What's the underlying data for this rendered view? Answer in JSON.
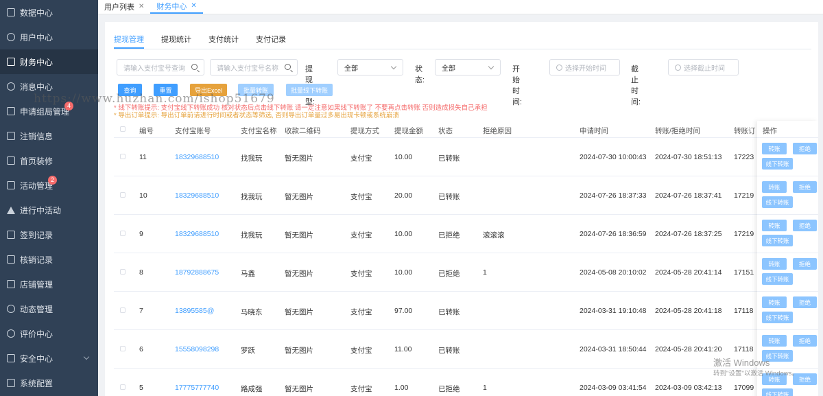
{
  "sidebar": {
    "items": [
      {
        "label": "数据中心",
        "icon": "chart-icon",
        "name": "sidebar-item-data-center",
        "active": false,
        "badge": ""
      },
      {
        "label": "用户中心",
        "icon": "user-icon",
        "name": "sidebar-item-user-center",
        "active": false,
        "badge": ""
      },
      {
        "label": "财务中心",
        "icon": "wallet-icon",
        "name": "sidebar-item-finance-center",
        "active": true,
        "badge": ""
      },
      {
        "label": "消息中心",
        "icon": "message-icon",
        "name": "sidebar-item-message-center",
        "active": false,
        "badge": ""
      },
      {
        "label": "申请组局管理",
        "icon": "apply-icon",
        "name": "sidebar-item-group-apply",
        "active": false,
        "badge": "4"
      },
      {
        "label": "注销信息",
        "icon": "document-icon",
        "name": "sidebar-item-cancel-info",
        "active": false,
        "badge": ""
      },
      {
        "label": "首页装修",
        "icon": "cube-icon",
        "name": "sidebar-item-home-decor",
        "active": false,
        "badge": ""
      },
      {
        "label": "活动管理",
        "icon": "clipboard-icon",
        "name": "sidebar-item-activity-manage",
        "active": false,
        "badge": "2"
      },
      {
        "label": "进行中活动",
        "icon": "send-icon",
        "name": "sidebar-item-ongoing-activity",
        "active": false,
        "badge": ""
      },
      {
        "label": "签到记录",
        "icon": "checkin-icon",
        "name": "sidebar-item-checkin-record",
        "active": false,
        "badge": ""
      },
      {
        "label": "核销记录",
        "icon": "layers-icon",
        "name": "sidebar-item-verify-record",
        "active": false,
        "badge": ""
      },
      {
        "label": "店铺管理",
        "icon": "shop-icon",
        "name": "sidebar-item-shop-manage",
        "active": false,
        "badge": ""
      },
      {
        "label": "动态管理",
        "icon": "pie-icon",
        "name": "sidebar-item-feed-manage",
        "active": false,
        "badge": ""
      },
      {
        "label": "评价中心",
        "icon": "comment-icon",
        "name": "sidebar-item-review-center",
        "active": false,
        "badge": ""
      },
      {
        "label": "安全中心",
        "icon": "shield-icon",
        "name": "sidebar-item-security-center",
        "active": false,
        "badge": "",
        "expandable": true
      },
      {
        "label": "系统配置",
        "icon": "list-icon",
        "name": "sidebar-item-system-config",
        "active": false,
        "badge": ""
      }
    ]
  },
  "tabbar": {
    "tabs": [
      {
        "label": "用户列表",
        "close": "✕",
        "active": false
      },
      {
        "label": "财务中心",
        "close": "✕",
        "active": true
      }
    ]
  },
  "subtabs": [
    "提现管理",
    "提现统计",
    "支付统计",
    "支付记录"
  ],
  "filters": {
    "alipay_account_placeholder": "请输入支付宝号查询",
    "alipay_name_placeholder": "请输入支付宝号名称",
    "withdraw_type_label": "提现类型:",
    "withdraw_type_value": "全部",
    "status_label": "状态:",
    "status_value": "全部",
    "start_label": "开始时间:",
    "start_placeholder": "选择开始时间",
    "end_label": "截止时间:",
    "end_placeholder": "选择截止时间"
  },
  "buttons": {
    "query": "查询",
    "reset": "重置",
    "export": "导出Excel",
    "batch_transfer": "批量转账",
    "batch_offline": "批量线下转账"
  },
  "tips": {
    "offline": "* 线下转账提示:  支付宝线下转账成功 核对状态后点击线下转账 请一定注意如果线下转账了 不要再点击转账 否则造成损失自己承担",
    "export": "* 导出订单提示:  导出订单前请进行时间或者状态等筛选, 否则导出订单量过多易出现卡顿或系统崩溃"
  },
  "table": {
    "headers": {
      "id": "编号",
      "account": "支付宝账号",
      "name": "支付宝名称",
      "qrcode": "收款二维码",
      "method": "提现方式",
      "amount": "提现金额",
      "status": "状态",
      "reason": "拒绝原因",
      "apply_time": "申请时间",
      "handle_time": "转账/拒绝时间",
      "order_no": "转账订",
      "ops": "操作"
    },
    "rows": [
      {
        "id": "11",
        "account": "18329688510",
        "name": "找我玩",
        "qrcode": "暂无图片",
        "method": "支付宝",
        "amount": "10.00",
        "status": "已转账",
        "reason": "",
        "apply_time": "2024-07-30 10:00:43",
        "handle_time": "2024-07-30 18:51:13",
        "order_no": "17223"
      },
      {
        "id": "10",
        "account": "18329688510",
        "name": "找我玩",
        "qrcode": "暂无图片",
        "method": "支付宝",
        "amount": "20.00",
        "status": "已转账",
        "reason": "",
        "apply_time": "2024-07-26 18:37:33",
        "handle_time": "2024-07-26 18:37:41",
        "order_no": "17219"
      },
      {
        "id": "9",
        "account": "18329688510",
        "name": "找我玩",
        "qrcode": "暂无图片",
        "method": "支付宝",
        "amount": "10.00",
        "status": "已拒绝",
        "reason": "滚滚滚",
        "apply_time": "2024-07-26 18:36:59",
        "handle_time": "2024-07-26 18:37:25",
        "order_no": "17219"
      },
      {
        "id": "8",
        "account": "18792888675",
        "name": "马鑫",
        "qrcode": "暂无图片",
        "method": "支付宝",
        "amount": "10.00",
        "status": "已拒绝",
        "reason": "1",
        "apply_time": "2024-05-08 20:10:02",
        "handle_time": "2024-05-28 20:41:14",
        "order_no": "17151"
      },
      {
        "id": "7",
        "account": "13895585@",
        "name": "马晓东",
        "qrcode": "暂无图片",
        "method": "支付宝",
        "amount": "97.00",
        "status": "已转账",
        "reason": "",
        "apply_time": "2024-03-31 19:10:48",
        "handle_time": "2024-05-28 20:41:18",
        "order_no": "17118"
      },
      {
        "id": "6",
        "account": "15558098298",
        "name": "罗跃",
        "qrcode": "暂无图片",
        "method": "支付宝",
        "amount": "11.00",
        "status": "已转账",
        "reason": "",
        "apply_time": "2024-03-31 18:50:44",
        "handle_time": "2024-05-28 20:41:20",
        "order_no": "17118"
      },
      {
        "id": "5",
        "account": "17775777740",
        "name": "路成强",
        "qrcode": "暂无图片",
        "method": "支付宝",
        "amount": "1.00",
        "status": "已拒绝",
        "reason": "1",
        "apply_time": "2024-03-09 03:41:54",
        "handle_time": "2024-03-09 03:42:13",
        "order_no": "17099"
      }
    ],
    "row_actions": {
      "transfer": "转账",
      "reject": "拒绝",
      "offline": "线下转账"
    }
  },
  "watermarks": {
    "url": "https://www.huzhan.com/ishop51679",
    "windows_line1": "激活 Windows",
    "windows_line2": "转到\"设置\"以激活 Windows。"
  }
}
